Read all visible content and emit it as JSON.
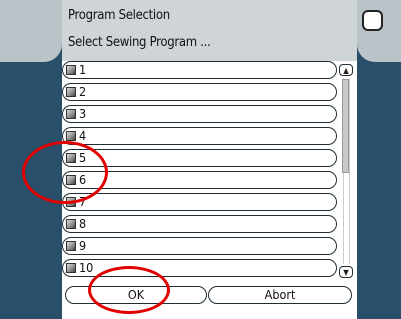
{
  "dialog": {
    "title": "Program Selection",
    "subtitle": "Select Sewing Program ..."
  },
  "programs": [
    "1",
    "2",
    "3",
    "4",
    "5",
    "6",
    "7",
    "8",
    "9",
    "10"
  ],
  "buttons": {
    "ok": "OK",
    "abort": "Abort"
  },
  "icons": {
    "scroll_up": "chevron-up-icon",
    "scroll_down": "chevron-down-icon",
    "checkbox": "checkbox-icon"
  },
  "colors": {
    "side_panel": "#2a4f6b",
    "header": "#cfd4d7",
    "annotation": "#e00000"
  }
}
